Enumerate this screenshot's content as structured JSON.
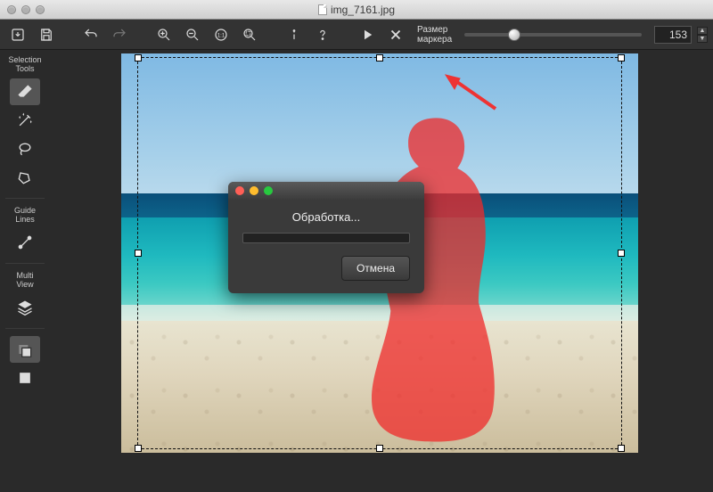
{
  "window": {
    "filename": "img_7161.jpg"
  },
  "toolbar": {
    "marker_label_1": "Размер",
    "marker_label_2": "маркера",
    "marker_size_value": "153",
    "slider_percent": 28
  },
  "sidebar": {
    "section_selection_1": "Selection",
    "section_selection_2": "Tools",
    "section_guide_1": "Guide",
    "section_guide_2": "Lines",
    "section_multi_1": "Multi",
    "section_multi_2": "View"
  },
  "dialog": {
    "title": "Обработка...",
    "cancel_label": "Отмена"
  }
}
